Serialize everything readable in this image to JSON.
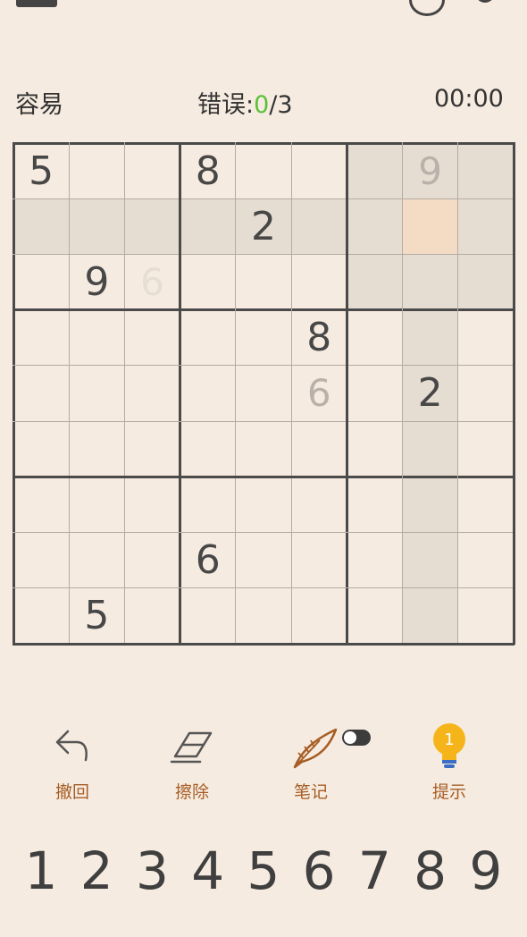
{
  "header": {
    "difficulty": "容易",
    "mistakes_label": "错误:",
    "mistakes_count": "0",
    "mistakes_sep": "/3",
    "timer": "00:00"
  },
  "board": {
    "rows": [
      [
        {
          "v": "5"
        },
        {
          "v": ""
        },
        {
          "v": ""
        },
        {
          "v": "8"
        },
        {
          "v": ""
        },
        {
          "v": ""
        },
        {
          "v": ""
        },
        {
          "v": "9",
          "s": "sub"
        },
        {
          "v": ""
        }
      ],
      [
        {
          "v": ""
        },
        {
          "v": ""
        },
        {
          "v": ""
        },
        {
          "v": ""
        },
        {
          "v": "2"
        },
        {
          "v": ""
        },
        {
          "v": ""
        },
        {
          "v": ""
        },
        {
          "v": ""
        }
      ],
      [
        {
          "v": ""
        },
        {
          "v": "9"
        },
        {
          "v": "6",
          "s": "faint"
        },
        {
          "v": ""
        },
        {
          "v": ""
        },
        {
          "v": ""
        },
        {
          "v": ""
        },
        {
          "v": ""
        },
        {
          "v": ""
        }
      ],
      [
        {
          "v": ""
        },
        {
          "v": ""
        },
        {
          "v": ""
        },
        {
          "v": ""
        },
        {
          "v": ""
        },
        {
          "v": "8"
        },
        {
          "v": ""
        },
        {
          "v": ""
        },
        {
          "v": ""
        }
      ],
      [
        {
          "v": ""
        },
        {
          "v": ""
        },
        {
          "v": ""
        },
        {
          "v": ""
        },
        {
          "v": ""
        },
        {
          "v": "6",
          "s": "sub"
        },
        {
          "v": ""
        },
        {
          "v": "2"
        },
        {
          "v": ""
        }
      ],
      [
        {
          "v": ""
        },
        {
          "v": ""
        },
        {
          "v": ""
        },
        {
          "v": ""
        },
        {
          "v": ""
        },
        {
          "v": ""
        },
        {
          "v": ""
        },
        {
          "v": ""
        },
        {
          "v": ""
        }
      ],
      [
        {
          "v": ""
        },
        {
          "v": ""
        },
        {
          "v": ""
        },
        {
          "v": ""
        },
        {
          "v": ""
        },
        {
          "v": ""
        },
        {
          "v": ""
        },
        {
          "v": ""
        },
        {
          "v": ""
        }
      ],
      [
        {
          "v": ""
        },
        {
          "v": ""
        },
        {
          "v": ""
        },
        {
          "v": "6"
        },
        {
          "v": ""
        },
        {
          "v": ""
        },
        {
          "v": ""
        },
        {
          "v": ""
        },
        {
          "v": ""
        }
      ],
      [
        {
          "v": ""
        },
        {
          "v": "5"
        },
        {
          "v": ""
        },
        {
          "v": ""
        },
        {
          "v": ""
        },
        {
          "v": ""
        },
        {
          "v": ""
        },
        {
          "v": ""
        },
        {
          "v": ""
        }
      ]
    ],
    "selected_cell": {
      "row": 1,
      "col": 7
    },
    "colors": {
      "cell": "#f6ebe0",
      "highlight": "#e6ddd2",
      "selected": "#f4dbc3"
    }
  },
  "toolbar": {
    "undo_label": "撤回",
    "erase_label": "擦除",
    "notes_label": "笔记",
    "hint_label": "提示",
    "hint_count": "1",
    "notes_toggle": "off",
    "accent": "#a65d25",
    "bulb_color": "#f5b51a"
  },
  "numpad": [
    "1",
    "2",
    "3",
    "4",
    "5",
    "6",
    "7",
    "8",
    "9"
  ],
  "icons": [
    "back-icon",
    "theme-icon",
    "gear-icon",
    "undo-icon",
    "eraser-icon",
    "quill-icon",
    "lightbulb-icon"
  ]
}
